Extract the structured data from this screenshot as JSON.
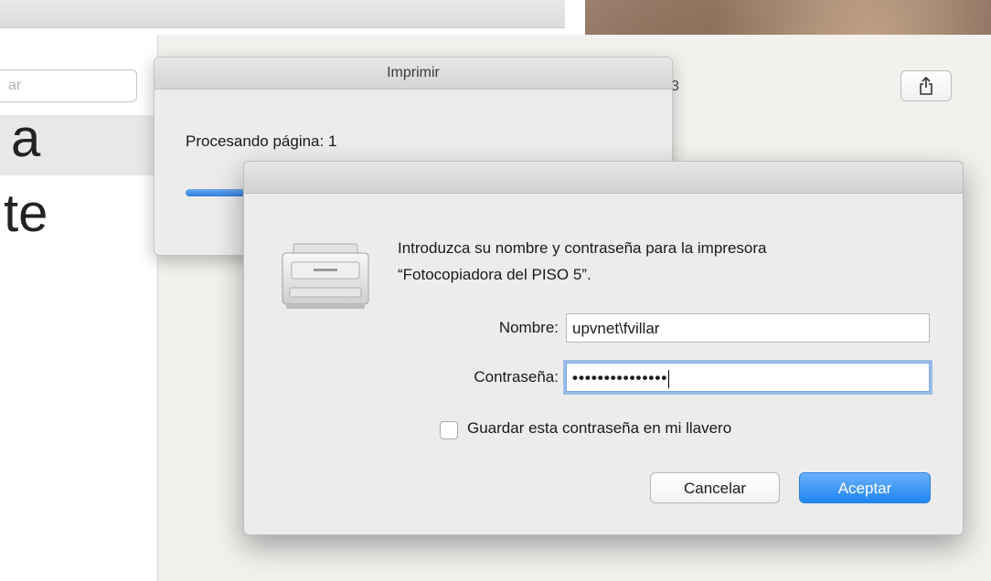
{
  "left_window": {
    "search_placeholder": "ar",
    "slide_text_1": "a",
    "slide_text_2": "te"
  },
  "doc_window": {
    "page_hint": "3",
    "share_icon": "share-icon"
  },
  "print_sheet": {
    "title": "Imprimir",
    "status": "Procesando página: 1",
    "progress": 0.13
  },
  "auth_dialog": {
    "icon": "printer-icon",
    "message_line1": "Introduzca su nombre y contraseña para la impresora",
    "message_line2": "“Fotocopiadora del PISO 5”.",
    "name_label": "Nombre:",
    "name_value": "upvnet\\fvillar",
    "password_label": "Contraseña:",
    "password_value": "•••••••••••••••",
    "save_checkbox_label": "Guardar esta contraseña en mi llavero",
    "save_checked": false,
    "cancel_label": "Cancelar",
    "ok_label": "Aceptar",
    "accent_color": "#2f86f0"
  }
}
